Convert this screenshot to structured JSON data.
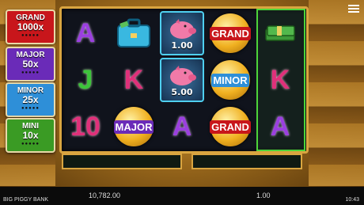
{
  "jackpots": [
    {
      "name": "GRAND",
      "value": "1000x",
      "color": "#c8161b",
      "top": 0
    },
    {
      "name": "MAJOR",
      "value": "50x",
      "color": "#6a2bb8",
      "top": 0
    },
    {
      "name": "MINOR",
      "value": "25x",
      "color": "#2e8fd8",
      "top": 0
    },
    {
      "name": "MINI",
      "value": "10x",
      "color": "#3a9b24",
      "top": 0
    }
  ],
  "jackpot_labels": {
    "grand": "GRAND",
    "grand_value": "1000x",
    "major": "MAJOR",
    "major_value": "50x",
    "minor": "MINOR",
    "minor_value": "25x",
    "mini": "MINI",
    "mini_value": "10x",
    "pips": "●●●●●"
  },
  "reels": {
    "r1": [
      "A",
      "J",
      "10"
    ],
    "r2": [
      "cash-case-icon",
      "K",
      "MAJOR"
    ],
    "r3": [
      "piggy-bank-icon",
      "piggy-bank-icon",
      "A"
    ],
    "r4": [
      "GRAND",
      "MINOR",
      "GRAND"
    ],
    "r5": [
      "cash-stack-icon",
      "K",
      "A"
    ]
  },
  "symbols": {
    "r1c1": "A",
    "r1c2": "J",
    "r1c3": "10",
    "r2c2": "K",
    "r2c3": "MAJOR",
    "r3c1": "1.00",
    "r3c2": "5.00",
    "r3c3": "A",
    "r4c1": "GRAND",
    "r4c2": "MINOR",
    "r4c3": "GRAND",
    "r5c2": "K",
    "r5c3": "A"
  },
  "footer": {
    "game_title": "BIG PIGGY BANK",
    "balance": "10,782.00",
    "bet": "1.00",
    "clock": "10:43"
  },
  "colors": {
    "frame": "#d9a540",
    "highlight": "#4dd43a",
    "letter_purple": "#9b3fe0",
    "letter_pink": "#e0307a",
    "letter_green": "#3cc43a"
  }
}
